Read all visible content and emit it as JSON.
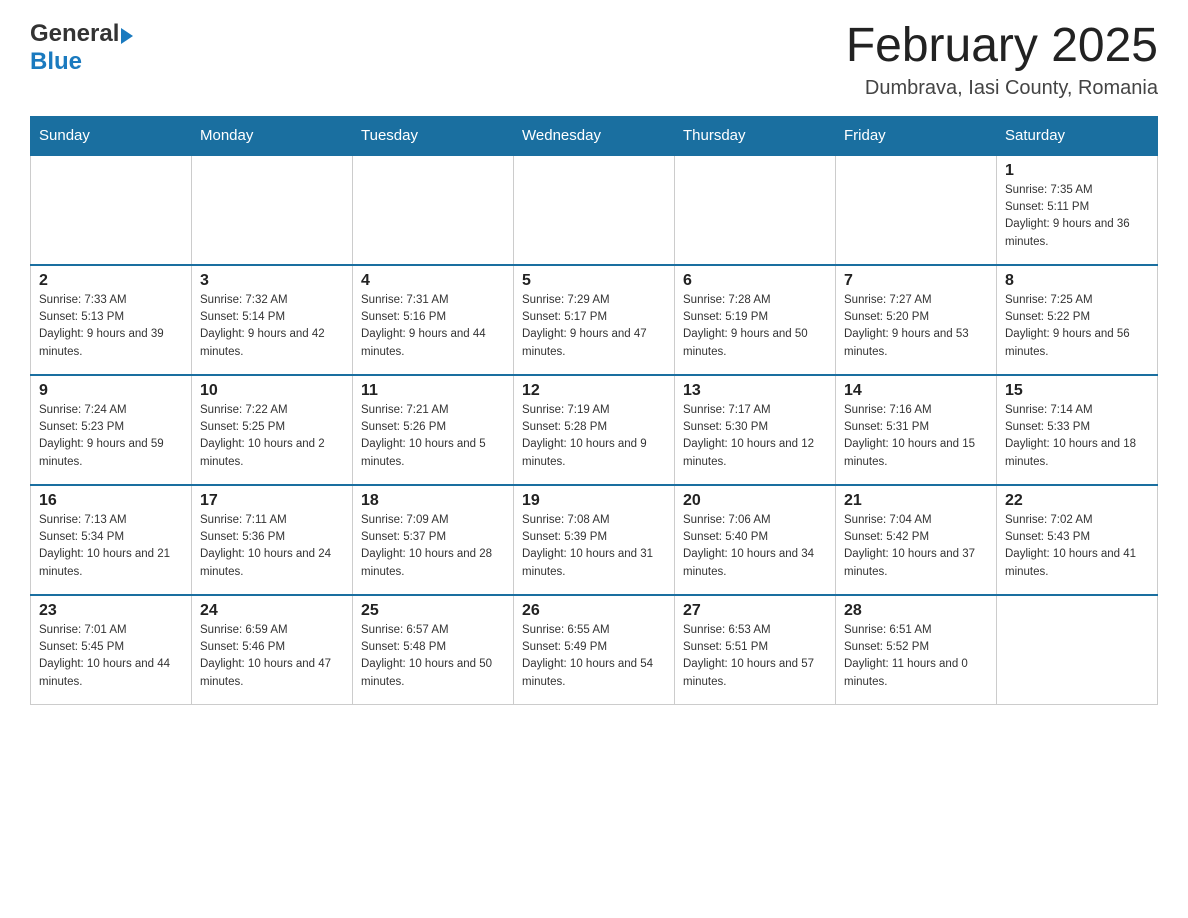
{
  "logo": {
    "general": "General",
    "blue": "Blue",
    "triangle": "▲"
  },
  "title": "February 2025",
  "subtitle": "Dumbrava, Iasi County, Romania",
  "days_of_week": [
    "Sunday",
    "Monday",
    "Tuesday",
    "Wednesday",
    "Thursday",
    "Friday",
    "Saturday"
  ],
  "weeks": [
    [
      {
        "day": "",
        "info": ""
      },
      {
        "day": "",
        "info": ""
      },
      {
        "day": "",
        "info": ""
      },
      {
        "day": "",
        "info": ""
      },
      {
        "day": "",
        "info": ""
      },
      {
        "day": "",
        "info": ""
      },
      {
        "day": "1",
        "info": "Sunrise: 7:35 AM\nSunset: 5:11 PM\nDaylight: 9 hours and 36 minutes."
      }
    ],
    [
      {
        "day": "2",
        "info": "Sunrise: 7:33 AM\nSunset: 5:13 PM\nDaylight: 9 hours and 39 minutes."
      },
      {
        "day": "3",
        "info": "Sunrise: 7:32 AM\nSunset: 5:14 PM\nDaylight: 9 hours and 42 minutes."
      },
      {
        "day": "4",
        "info": "Sunrise: 7:31 AM\nSunset: 5:16 PM\nDaylight: 9 hours and 44 minutes."
      },
      {
        "day": "5",
        "info": "Sunrise: 7:29 AM\nSunset: 5:17 PM\nDaylight: 9 hours and 47 minutes."
      },
      {
        "day": "6",
        "info": "Sunrise: 7:28 AM\nSunset: 5:19 PM\nDaylight: 9 hours and 50 minutes."
      },
      {
        "day": "7",
        "info": "Sunrise: 7:27 AM\nSunset: 5:20 PM\nDaylight: 9 hours and 53 minutes."
      },
      {
        "day": "8",
        "info": "Sunrise: 7:25 AM\nSunset: 5:22 PM\nDaylight: 9 hours and 56 minutes."
      }
    ],
    [
      {
        "day": "9",
        "info": "Sunrise: 7:24 AM\nSunset: 5:23 PM\nDaylight: 9 hours and 59 minutes."
      },
      {
        "day": "10",
        "info": "Sunrise: 7:22 AM\nSunset: 5:25 PM\nDaylight: 10 hours and 2 minutes."
      },
      {
        "day": "11",
        "info": "Sunrise: 7:21 AM\nSunset: 5:26 PM\nDaylight: 10 hours and 5 minutes."
      },
      {
        "day": "12",
        "info": "Sunrise: 7:19 AM\nSunset: 5:28 PM\nDaylight: 10 hours and 9 minutes."
      },
      {
        "day": "13",
        "info": "Sunrise: 7:17 AM\nSunset: 5:30 PM\nDaylight: 10 hours and 12 minutes."
      },
      {
        "day": "14",
        "info": "Sunrise: 7:16 AM\nSunset: 5:31 PM\nDaylight: 10 hours and 15 minutes."
      },
      {
        "day": "15",
        "info": "Sunrise: 7:14 AM\nSunset: 5:33 PM\nDaylight: 10 hours and 18 minutes."
      }
    ],
    [
      {
        "day": "16",
        "info": "Sunrise: 7:13 AM\nSunset: 5:34 PM\nDaylight: 10 hours and 21 minutes."
      },
      {
        "day": "17",
        "info": "Sunrise: 7:11 AM\nSunset: 5:36 PM\nDaylight: 10 hours and 24 minutes."
      },
      {
        "day": "18",
        "info": "Sunrise: 7:09 AM\nSunset: 5:37 PM\nDaylight: 10 hours and 28 minutes."
      },
      {
        "day": "19",
        "info": "Sunrise: 7:08 AM\nSunset: 5:39 PM\nDaylight: 10 hours and 31 minutes."
      },
      {
        "day": "20",
        "info": "Sunrise: 7:06 AM\nSunset: 5:40 PM\nDaylight: 10 hours and 34 minutes."
      },
      {
        "day": "21",
        "info": "Sunrise: 7:04 AM\nSunset: 5:42 PM\nDaylight: 10 hours and 37 minutes."
      },
      {
        "day": "22",
        "info": "Sunrise: 7:02 AM\nSunset: 5:43 PM\nDaylight: 10 hours and 41 minutes."
      }
    ],
    [
      {
        "day": "23",
        "info": "Sunrise: 7:01 AM\nSunset: 5:45 PM\nDaylight: 10 hours and 44 minutes."
      },
      {
        "day": "24",
        "info": "Sunrise: 6:59 AM\nSunset: 5:46 PM\nDaylight: 10 hours and 47 minutes."
      },
      {
        "day": "25",
        "info": "Sunrise: 6:57 AM\nSunset: 5:48 PM\nDaylight: 10 hours and 50 minutes."
      },
      {
        "day": "26",
        "info": "Sunrise: 6:55 AM\nSunset: 5:49 PM\nDaylight: 10 hours and 54 minutes."
      },
      {
        "day": "27",
        "info": "Sunrise: 6:53 AM\nSunset: 5:51 PM\nDaylight: 10 hours and 57 minutes."
      },
      {
        "day": "28",
        "info": "Sunrise: 6:51 AM\nSunset: 5:52 PM\nDaylight: 11 hours and 0 minutes."
      },
      {
        "day": "",
        "info": ""
      }
    ]
  ]
}
